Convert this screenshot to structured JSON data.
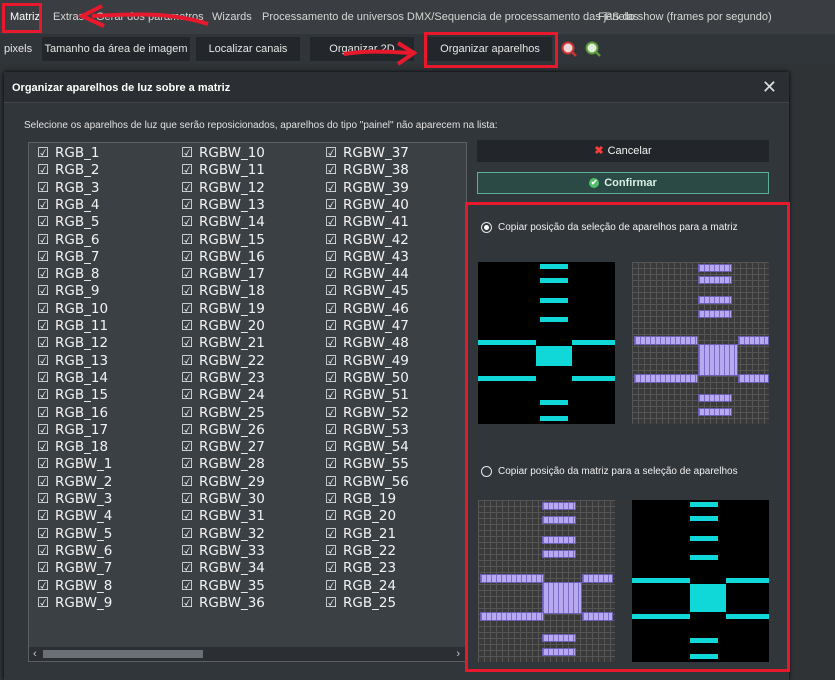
{
  "menu": {
    "items": [
      "Matriz",
      "Extras",
      "Gerar dos parametros",
      "Wizards",
      "Processamento de universos DMX/Sequencia de processamento das janelas",
      "FPS do show (frames por segundo)"
    ]
  },
  "toolbar": {
    "pixels_label": "pixels",
    "image_area": "Tamanho da área de imagem",
    "find_channels": "Localizar canais",
    "organize_2d": "Organizar 2D",
    "organize_fixtures": "Organizar aparelhos"
  },
  "dialog": {
    "title": "Organizar aparelhos de luz sobre a matriz",
    "close": "✕",
    "instruction": "Selecione os aparelhos de luz que serão reposicionados, aparelhos do tipo \"painel\" não aparecem na lista:",
    "cancel": "Cancelar",
    "confirm": "Confirmar",
    "radio1": "Copiar posição da seleção de aparelhos para a matriz",
    "radio2": "Copiar posição da matriz para a seleção de aparelhos",
    "scroll_left": "‹",
    "scroll_right": "›"
  },
  "fixtures": {
    "col1": [
      "RGB_1",
      "RGB_2",
      "RGB_3",
      "RGB_4",
      "RGB_5",
      "RGB_6",
      "RGB_7",
      "RGB_8",
      "RGB_9",
      "RGB_10",
      "RGB_11",
      "RGB_12",
      "RGB_13",
      "RGB_14",
      "RGB_15",
      "RGB_16",
      "RGB_17",
      "RGB_18",
      "RGBW_1",
      "RGBW_2",
      "RGBW_3",
      "RGBW_4",
      "RGBW_5",
      "RGBW_6",
      "RGBW_7",
      "RGBW_8",
      "RGBW_9"
    ],
    "col2": [
      "RGBW_10",
      "RGBW_11",
      "RGBW_12",
      "RGBW_13",
      "RGBW_14",
      "RGBW_15",
      "RGBW_16",
      "RGBW_17",
      "RGBW_18",
      "RGBW_19",
      "RGBW_20",
      "RGBW_21",
      "RGBW_22",
      "RGBW_23",
      "RGBW_24",
      "RGBW_25",
      "RGBW_26",
      "RGBW_27",
      "RGBW_28",
      "RGBW_29",
      "RGBW_30",
      "RGBW_31",
      "RGBW_32",
      "RGBW_33",
      "RGBW_34",
      "RGBW_35",
      "RGBW_36"
    ],
    "col3": [
      "RGBW_37",
      "RGBW_38",
      "RGBW_39",
      "RGBW_40",
      "RGBW_41",
      "RGBW_42",
      "RGBW_43",
      "RGBW_44",
      "RGBW_45",
      "RGBW_46",
      "RGBW_47",
      "RGBW_48",
      "RGBW_49",
      "RGBW_50",
      "RGBW_51",
      "RGBW_52",
      "RGBW_53",
      "RGBW_54",
      "RGBW_55",
      "RGBW_56",
      "RGB_19",
      "RGB_20",
      "RGB_21",
      "RGB_22",
      "RGB_23",
      "RGB_24",
      "RGB_25"
    ],
    "checkmark": "☑"
  },
  "colors": {
    "accent_cyan": "#10d8d8",
    "fixture_purple": "#b8a8ef",
    "annotation_red": "#e8192c"
  },
  "icons": {
    "cancel": "x-icon",
    "confirm": "check-circle-icon",
    "toolbar_zoom_red": "zoom-red-icon",
    "toolbar_zoom_green": "zoom-green-icon"
  }
}
